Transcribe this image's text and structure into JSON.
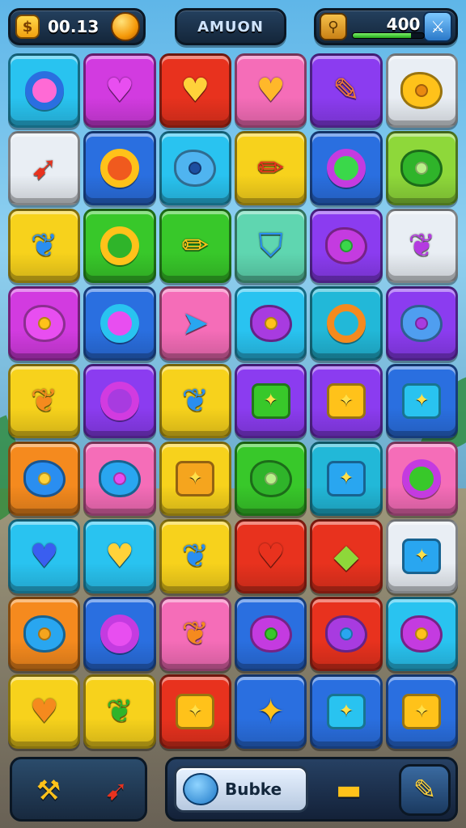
{
  "header": {
    "left_value": "00.13",
    "title": "AMUON",
    "energy_value": "400",
    "energy_level": 0.82
  },
  "colors": {
    "cyan": "#29c3f0",
    "magenta": "#d23be0",
    "red": "#e8321e",
    "pink": "#f56db8",
    "purple": "#8b3cf0",
    "white": "#e9eef4",
    "yellow": "#f7d21c",
    "blue": "#2a6fe0",
    "green": "#38c82a",
    "orange": "#f58a1e",
    "mint": "#5fd6b0",
    "lime": "#8ed83a",
    "teal": "#22b8d8"
  },
  "board": {
    "rows": [
      [
        {
          "bg": "cyan",
          "icon": "gem-blob-icon",
          "glyph": "ring",
          "c": "#2a6fe0",
          "core": "#ff6ad5"
        },
        {
          "bg": "magenta",
          "icon": "heart-icon",
          "glyph": "♥",
          "fg": "#e84ef0"
        },
        {
          "bg": "red",
          "icon": "yellow-heart-icon",
          "glyph": "♥",
          "fg": "#ffd23a"
        },
        {
          "bg": "pink",
          "icon": "yellow-heart-icon",
          "glyph": "♥",
          "fg": "#ffb82a"
        },
        {
          "bg": "purple",
          "icon": "feather-pen-icon",
          "glyph": "✎",
          "fg": "#f0783a"
        },
        {
          "bg": "white",
          "icon": "yellow-blob-icon",
          "glyph": "blob",
          "c": "#ffc21a",
          "core": "#e98a10"
        }
      ],
      [
        {
          "bg": "white",
          "icon": "rocket-dart-icon",
          "glyph": "➹",
          "fg": "#e8321e"
        },
        {
          "bg": "blue",
          "icon": "yellow-ring-icon",
          "glyph": "ring",
          "c": "#ffc21a",
          "core": "#f05a1e"
        },
        {
          "bg": "cyan",
          "icon": "blue-blob-icon",
          "glyph": "blob",
          "c": "#4fb4f0",
          "core": "#1d4fa0"
        },
        {
          "bg": "yellow",
          "icon": "pencil-icon",
          "glyph": "✏",
          "fg": "#e8321e"
        },
        {
          "bg": "blue",
          "icon": "purple-ring-icon",
          "glyph": "ring",
          "c": "#c43be0",
          "core": "#3ad84a"
        },
        {
          "bg": "lime",
          "icon": "green-blob-icon",
          "glyph": "blob",
          "c": "#2fb42a",
          "core": "#b8f08a"
        }
      ],
      [
        {
          "bg": "yellow",
          "icon": "leaf-icon",
          "glyph": "❦",
          "fg": "#2a8ef0"
        },
        {
          "bg": "green",
          "icon": "yellow-ring-icon",
          "glyph": "ring",
          "c": "#ffc21a",
          "core": "#2fb42a"
        },
        {
          "bg": "green",
          "icon": "pencil-icon",
          "glyph": "✏",
          "fg": "#ffc21a"
        },
        {
          "bg": "mint",
          "icon": "shield-icon",
          "glyph": "⛉",
          "fg": "#2a8ef0"
        },
        {
          "bg": "purple",
          "icon": "flower-icon",
          "glyph": "blob",
          "c": "#c43be0",
          "core": "#3ad84a"
        },
        {
          "bg": "white",
          "icon": "purple-leaf-icon",
          "glyph": "❦",
          "fg": "#b43be0"
        }
      ],
      [
        {
          "bg": "magenta",
          "icon": "crown-blob-icon",
          "glyph": "blob",
          "c": "#e84ef0",
          "core": "#ffc21a"
        },
        {
          "bg": "blue",
          "icon": "cyan-ring-icon",
          "glyph": "ring",
          "c": "#29c3f0",
          "core": "#e84ef0"
        },
        {
          "bg": "pink",
          "icon": "arrow-dart-icon",
          "glyph": "➤",
          "fg": "#29a6f0"
        },
        {
          "bg": "cyan",
          "icon": "flower-icon",
          "glyph": "blob",
          "c": "#a83be0",
          "core": "#ffc21a"
        },
        {
          "bg": "teal",
          "icon": "orange-ring-icon",
          "glyph": "ring",
          "c": "#f58a1e",
          "core": "#22b8d8"
        },
        {
          "bg": "purple",
          "icon": "blue-blob-icon",
          "glyph": "blob",
          "c": "#4f9ef0",
          "core": "#a83be0"
        }
      ],
      [
        {
          "bg": "yellow",
          "icon": "spotted-leaf-icon",
          "glyph": "❦",
          "fg": "#f58a1e"
        },
        {
          "bg": "purple",
          "icon": "magenta-ring-icon",
          "glyph": "ring",
          "c": "#d23be0",
          "core": "#a83be0"
        },
        {
          "bg": "yellow",
          "icon": "blue-leaf-icon",
          "glyph": "❦",
          "fg": "#2a8ef0"
        },
        {
          "bg": "purple",
          "icon": "green-square-icon",
          "glyph": "square",
          "c": "#38c82a"
        },
        {
          "bg": "purple",
          "icon": "yellow-square-icon",
          "glyph": "square",
          "c": "#ffc21a"
        },
        {
          "bg": "blue",
          "icon": "cyan-square-icon",
          "glyph": "square",
          "c": "#29c3f0"
        }
      ],
      [
        {
          "bg": "orange",
          "icon": "star-blob-icon",
          "glyph": "blob",
          "c": "#2a8ef0",
          "core": "#ffd23a"
        },
        {
          "bg": "pink",
          "icon": "flower-icon",
          "glyph": "blob",
          "c": "#29a6f0",
          "core": "#e84ef0"
        },
        {
          "bg": "yellow",
          "icon": "orange-square-icon",
          "glyph": "square",
          "c": "#f5a51e"
        },
        {
          "bg": "green",
          "icon": "green-blob-icon",
          "glyph": "blob",
          "c": "#2fb42a",
          "core": "#b8f08a"
        },
        {
          "bg": "teal",
          "icon": "blue-square-icon",
          "glyph": "square",
          "c": "#29a6f0"
        },
        {
          "bg": "pink",
          "icon": "purple-ring-icon",
          "glyph": "ring",
          "c": "#c43be0",
          "core": "#38c82a"
        }
      ],
      [
        {
          "bg": "cyan",
          "icon": "blue-heart-icon",
          "glyph": "♥",
          "fg": "#3a5ef0"
        },
        {
          "bg": "cyan",
          "icon": "yellow-heart-icon",
          "glyph": "♥",
          "fg": "#ffd23a"
        },
        {
          "bg": "yellow",
          "icon": "blue-leaf-icon",
          "glyph": "❦",
          "fg": "#2a8ef0"
        },
        {
          "bg": "red",
          "icon": "red-heart-icon",
          "glyph": "♥",
          "fg": "#e8321e"
        },
        {
          "bg": "red",
          "icon": "kite-icon",
          "glyph": "◆",
          "fg": "#8ed83a"
        },
        {
          "bg": "white",
          "icon": "star-square-icon",
          "glyph": "square",
          "c": "#29a6f0"
        }
      ],
      [
        {
          "bg": "orange",
          "icon": "blue-blob-icon",
          "glyph": "blob",
          "c": "#29a6f0",
          "core": "#f5a51e"
        },
        {
          "bg": "blue",
          "icon": "purple-ring-icon",
          "glyph": "ring",
          "c": "#c43be0",
          "core": "#e84ef0"
        },
        {
          "bg": "pink",
          "icon": "orange-leaf-icon",
          "glyph": "❦",
          "fg": "#f58a1e"
        },
        {
          "bg": "blue",
          "icon": "flower-icon",
          "glyph": "blob",
          "c": "#c43be0",
          "core": "#38c82a"
        },
        {
          "bg": "red",
          "icon": "purple-blob-icon",
          "glyph": "blob",
          "c": "#a83be0",
          "core": "#29a6f0"
        },
        {
          "bg": "cyan",
          "icon": "flower-icon",
          "glyph": "blob",
          "c": "#c43be0",
          "core": "#ffc21a"
        }
      ],
      [
        {
          "bg": "yellow",
          "icon": "orange-heart-icon",
          "glyph": "♥",
          "fg": "#f58a1e"
        },
        {
          "bg": "yellow",
          "icon": "green-leaf-icon",
          "glyph": "❦",
          "fg": "#2fb42a"
        },
        {
          "bg": "red",
          "icon": "check-square-icon",
          "glyph": "square",
          "c": "#ffc21a"
        },
        {
          "bg": "blue",
          "icon": "torch-icon",
          "glyph": "✦",
          "fg": "#ffc21a"
        },
        {
          "bg": "blue",
          "icon": "star-square-icon",
          "glyph": "square",
          "c": "#29c3f0"
        },
        {
          "bg": "blue",
          "icon": "cheese-icon",
          "glyph": "square",
          "c": "#ffc21a"
        }
      ]
    ]
  },
  "footer": {
    "tool_left_1": "hammer-icon",
    "tool_left_2": "rocket-icon",
    "bubble_label": "Bubke",
    "tool_right_1": "cannon-icon",
    "tool_right_2": "mallet-icon"
  }
}
